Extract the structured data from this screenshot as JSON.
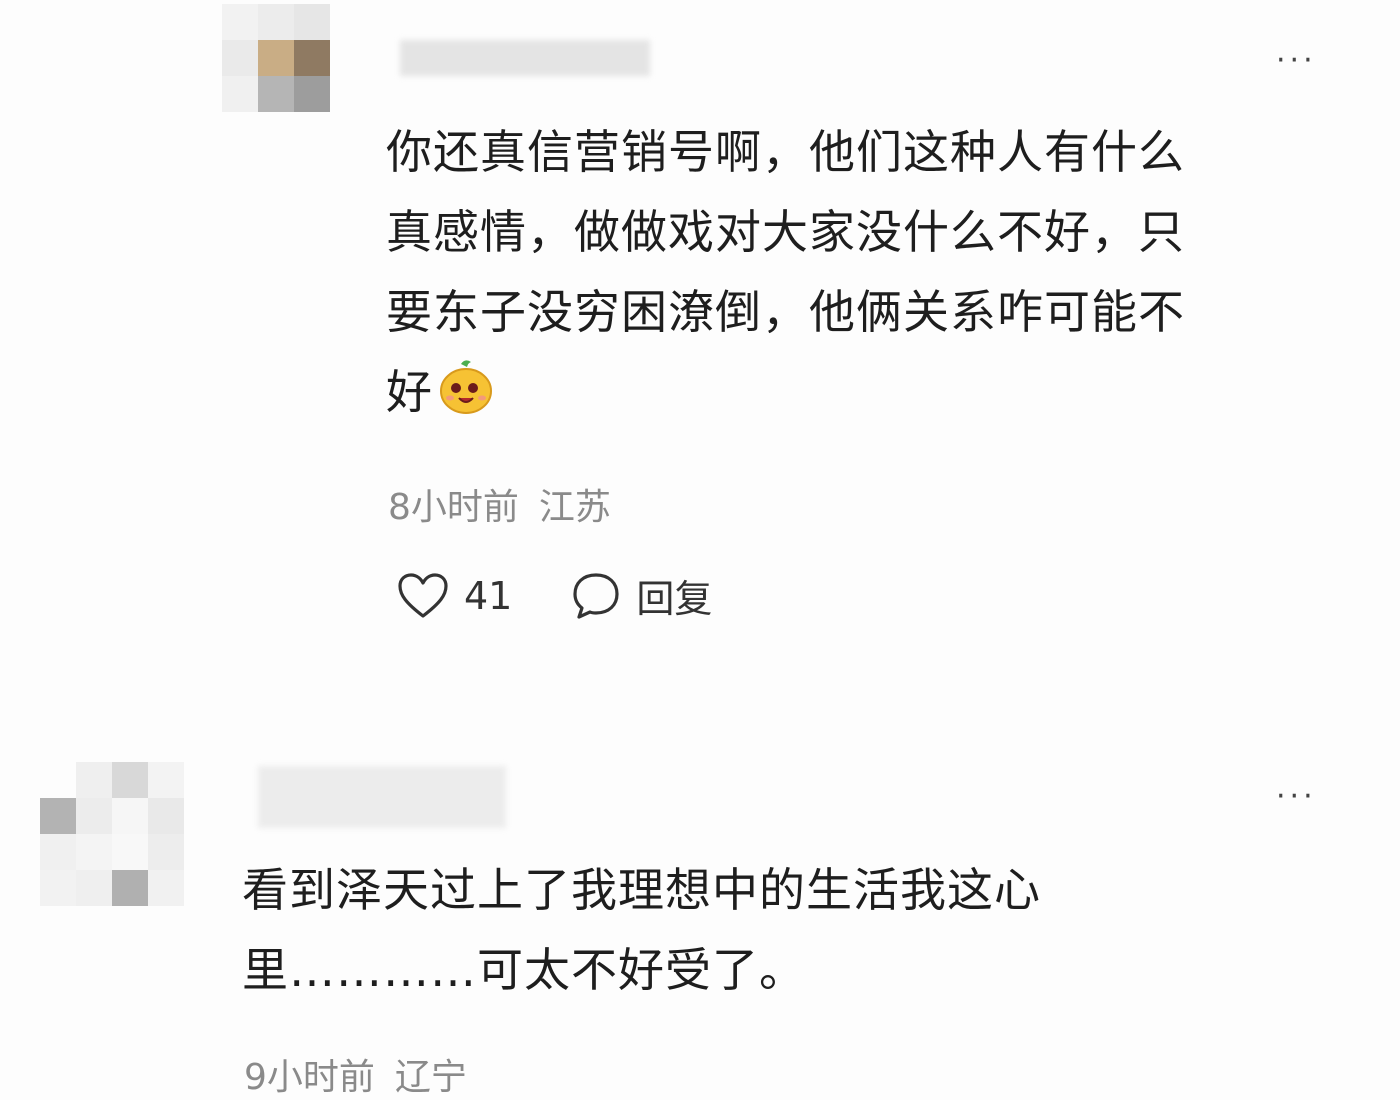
{
  "comments": [
    {
      "more_label": "···",
      "text_lines": [
        "你还真信营销号啊，他们这种人有什么",
        "真感情，做做戏对大家没什么不好，只",
        "要东子没穷困潦倒，他俩关系咋可能不",
        "好"
      ],
      "emoji": "grinning-face-emoji",
      "time": "8小时前",
      "location": "江苏",
      "like_icon": "heart-icon",
      "like_count": "41",
      "reply_icon": "chat-bubble-icon",
      "reply_label": "回复"
    },
    {
      "more_label": "···",
      "text_lines": [
        "看到泽天过上了我理想中的生活我这心",
        "里…………可太不好受了。"
      ],
      "time": "9小时前",
      "location": "辽宁"
    }
  ],
  "colors": {
    "background": "#fdfdfd",
    "text": "#1e1e1e",
    "meta": "#8a8a8a"
  }
}
